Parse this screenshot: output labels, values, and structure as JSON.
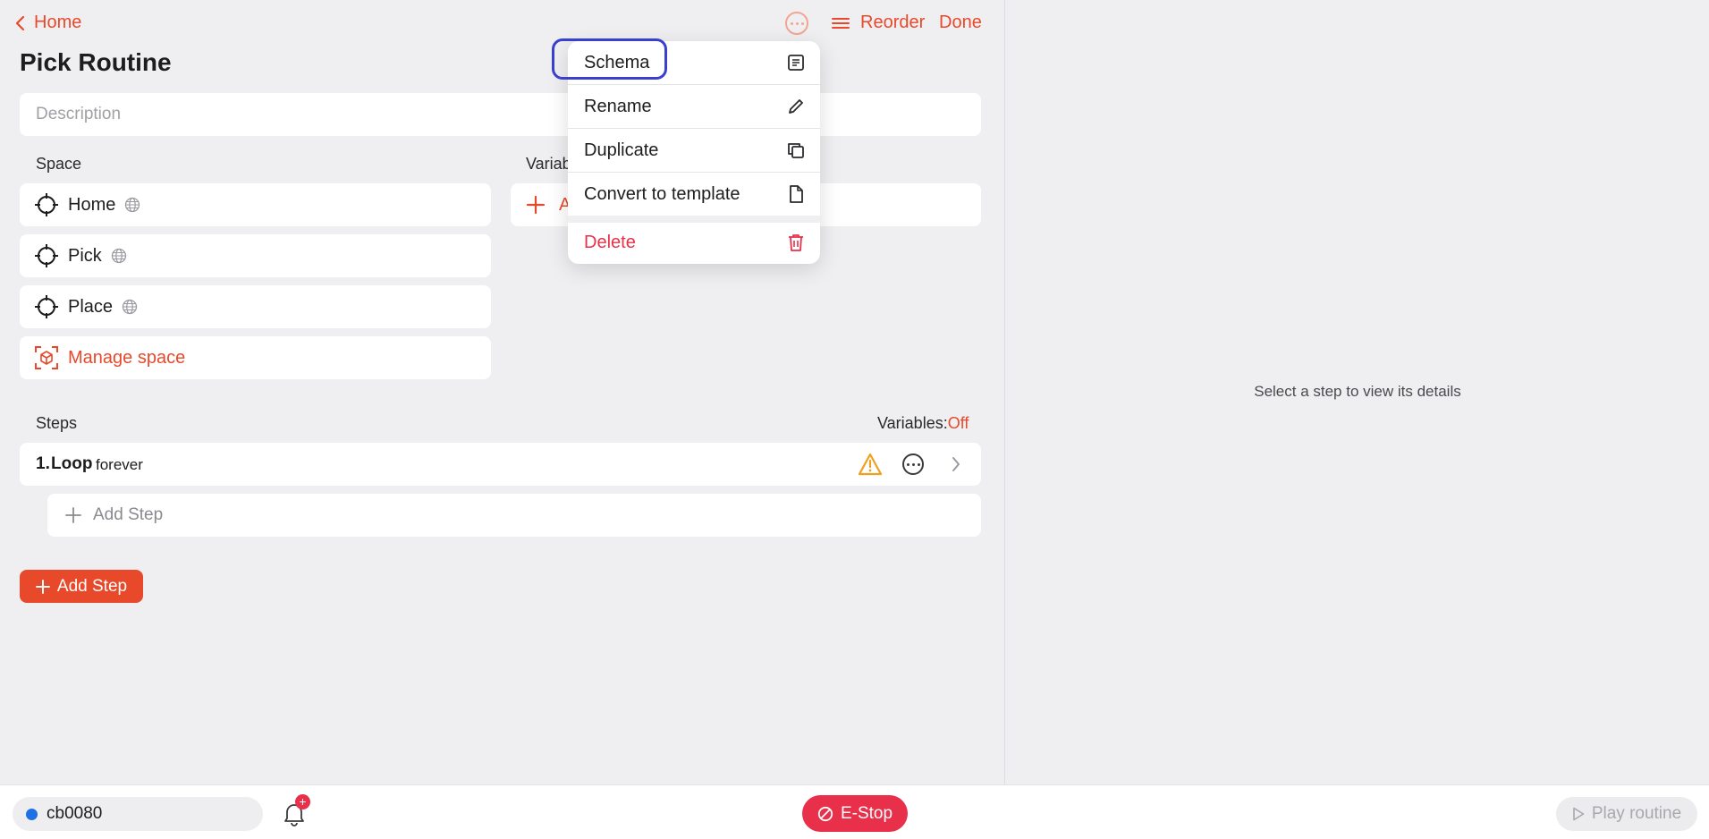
{
  "nav": {
    "back_label": "Home",
    "reorder_label": "Reorder",
    "done_label": "Done"
  },
  "routine": {
    "title": "Pick Routine",
    "description_placeholder": "Description"
  },
  "space": {
    "heading": "Space",
    "items": [
      {
        "label": "Home"
      },
      {
        "label": "Pick"
      },
      {
        "label": "Place"
      }
    ],
    "manage_label": "Manage space"
  },
  "variables": {
    "heading_visible": "Variab",
    "add_visible": "A"
  },
  "steps": {
    "heading": "Steps",
    "variables_label": "Variables:",
    "variables_state": "Off",
    "items": [
      {
        "number": "1.",
        "name": "Loop",
        "detail": "forever"
      }
    ],
    "add_step_inner": "Add Step",
    "add_step_button": "Add Step"
  },
  "details": {
    "empty_text": "Select a step to view its details"
  },
  "menu": {
    "items": [
      {
        "label": "Schema",
        "icon": "schema-icon"
      },
      {
        "label": "Rename",
        "icon": "pencil-icon"
      },
      {
        "label": "Duplicate",
        "icon": "copy-icon"
      },
      {
        "label": "Convert to template",
        "icon": "document-icon"
      },
      {
        "label": "Delete",
        "icon": "trash-icon"
      }
    ]
  },
  "bottom": {
    "robot_name": "cb0080",
    "estop_label": "E-Stop",
    "play_label": "Play routine"
  },
  "colors": {
    "accent": "#e8492a",
    "danger": "#e8304a",
    "warning": "#f0a020",
    "highlight": "#3a3fd0",
    "status_dot": "#1f6fe5"
  }
}
